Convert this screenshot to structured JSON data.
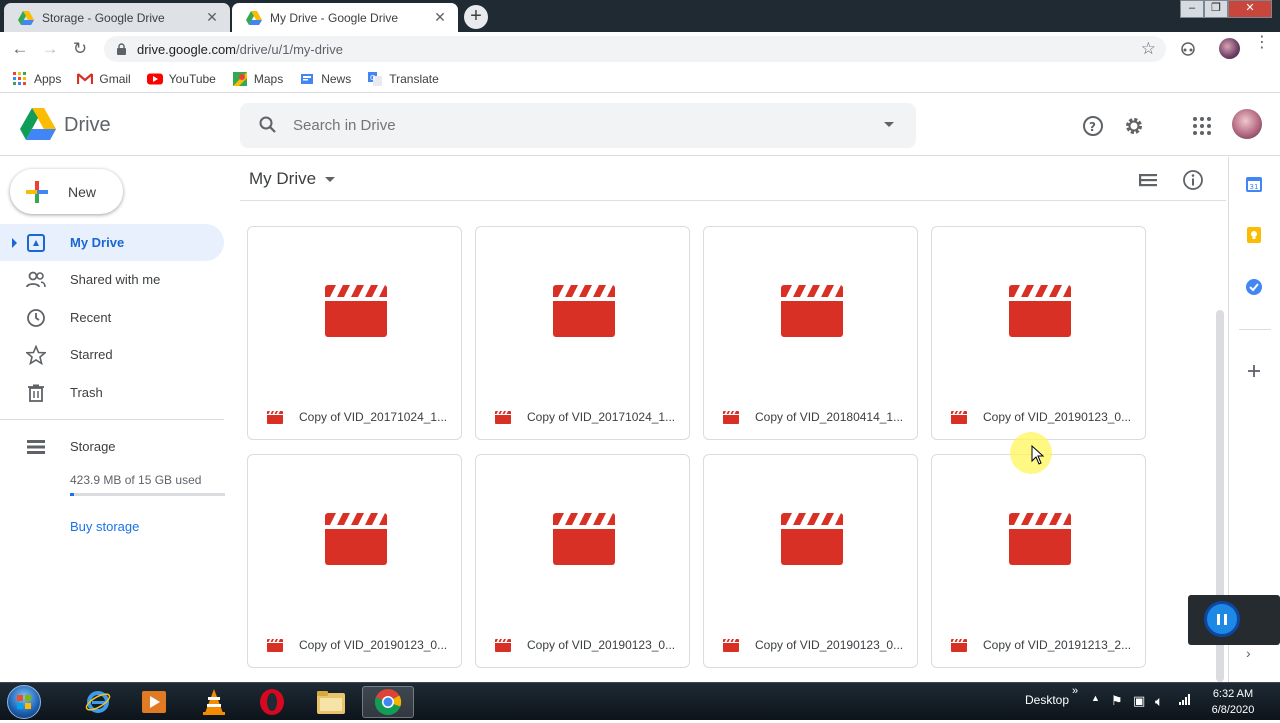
{
  "browser": {
    "tabs": [
      {
        "title": "Storage - Google Drive",
        "active": false
      },
      {
        "title": "My Drive - Google Drive",
        "active": true
      }
    ],
    "url_host": "drive.google.com",
    "url_path": "/drive/u/1/my-drive",
    "bookmarks": [
      "Apps",
      "Gmail",
      "YouTube",
      "Maps",
      "News",
      "Translate"
    ]
  },
  "header": {
    "app_name": "Drive",
    "search_placeholder": "Search in Drive"
  },
  "sidebar": {
    "new_label": "New",
    "items": [
      {
        "label": "My Drive",
        "selected": true
      },
      {
        "label": "Shared with me"
      },
      {
        "label": "Recent"
      },
      {
        "label": "Starred"
      },
      {
        "label": "Trash"
      }
    ],
    "storage_label": "Storage",
    "usage_text": "423.9 MB of 15 GB used",
    "usage_fraction": 0.028,
    "buy_label": "Buy storage"
  },
  "main": {
    "title": "My Drive",
    "files": [
      "Copy of VID_20171024_1...",
      "Copy of VID_20171024_1...",
      "Copy of VID_20180414_1...",
      "Copy of VID_20190123_0...",
      "Copy of VID_20190123_0...",
      "Copy of VID_20190123_0...",
      "Copy of VID_20190123_0...",
      "Copy of VID_20191213_2..."
    ]
  },
  "taskbar": {
    "desktop_label": "Desktop",
    "time": "6:32 AM",
    "date": "6/8/2020"
  },
  "colors": {
    "video_red": "#d93025",
    "selected_bg": "#e8f0fe",
    "selected_text": "#1967d2",
    "link_blue": "#1a73e8"
  }
}
